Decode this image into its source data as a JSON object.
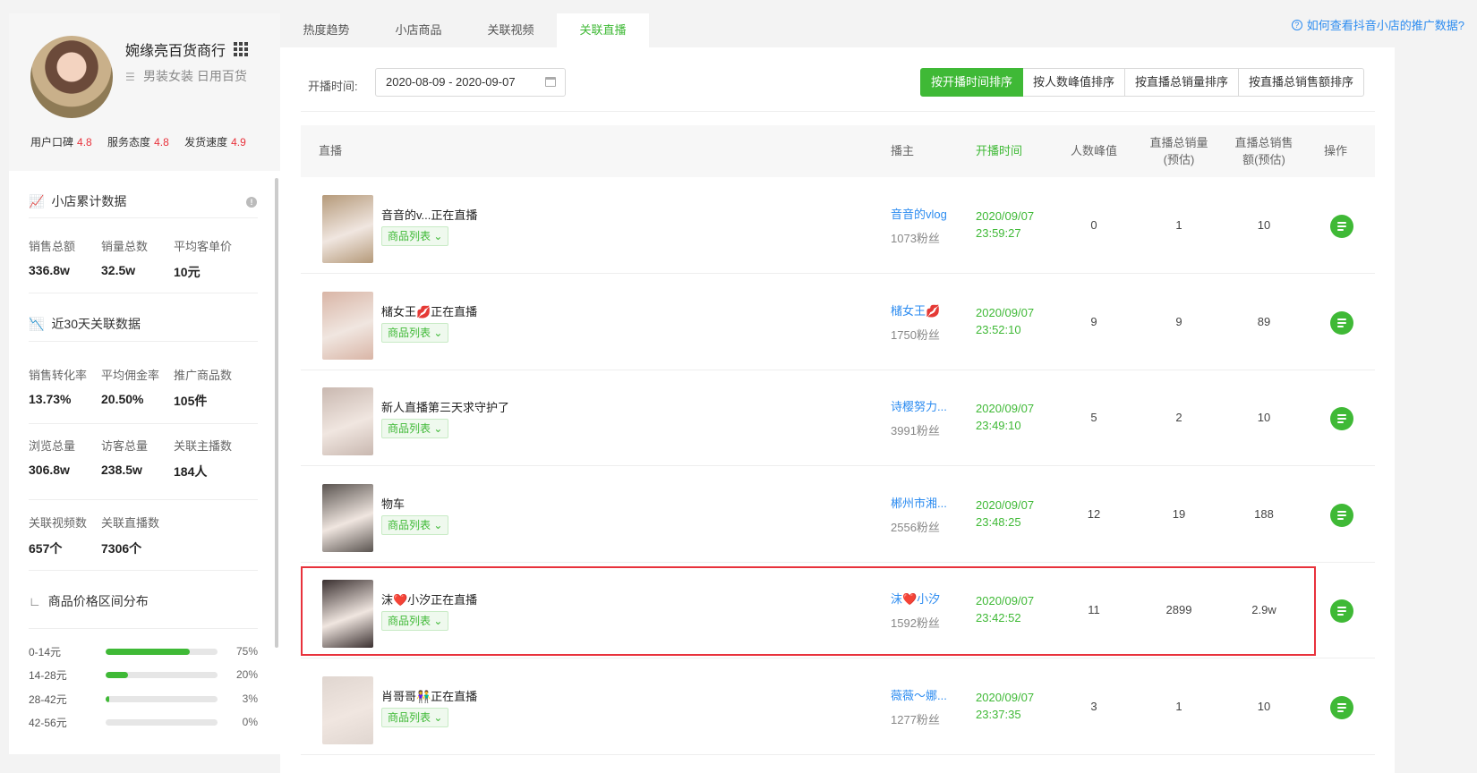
{
  "shop": {
    "name": "婉缘亮百货商行",
    "category": "男装女装 日用百货",
    "ratings": [
      {
        "label": "用户口碑",
        "value": "4.8"
      },
      {
        "label": "服务态度",
        "value": "4.8"
      },
      {
        "label": "发货速度",
        "value": "4.9"
      }
    ]
  },
  "cumulative": {
    "title": "小店累计数据",
    "stats": [
      {
        "label": "销售总额",
        "value": "336.8w"
      },
      {
        "label": "销量总数",
        "value": "32.5w"
      },
      {
        "label": "平均客单价",
        "value": "10元"
      }
    ]
  },
  "recent": {
    "title": "近30天关联数据",
    "stats": [
      {
        "label": "销售转化率",
        "value": "13.73%"
      },
      {
        "label": "平均佣金率",
        "value": "20.50%"
      },
      {
        "label": "推广商品数",
        "value": "105件"
      },
      {
        "label": "浏览总量",
        "value": "306.8w"
      },
      {
        "label": "访客总量",
        "value": "238.5w"
      },
      {
        "label": "关联主播数",
        "value": "184人"
      },
      {
        "label": "关联视频数",
        "value": "657个"
      },
      {
        "label": "关联直播数",
        "value": "7306个"
      }
    ]
  },
  "price": {
    "title": "商品价格区间分布",
    "ranges": [
      {
        "label": "0-14元",
        "pct": "75%",
        "ratio": 0.75
      },
      {
        "label": "14-28元",
        "pct": "20%",
        "ratio": 0.2
      },
      {
        "label": "28-42元",
        "pct": "3%",
        "ratio": 0.03
      },
      {
        "label": "42-56元",
        "pct": "0%",
        "ratio": 0.0
      }
    ]
  },
  "tabs": [
    "热度趋势",
    "小店商品",
    "关联视频",
    "关联直播"
  ],
  "help_link": "如何查看抖音小店的推广数据?",
  "filter": {
    "label": "开播时间:",
    "date_range": "2020-08-09 - 2020-09-07"
  },
  "sort_buttons": [
    "按开播时间排序",
    "按人数峰值排序",
    "按直播总销量排序",
    "按直播总销售额排序"
  ],
  "columns": {
    "live": "直播",
    "host": "播主",
    "start_time": "开播时间",
    "peak": "人数峰值",
    "sales_l1": "直播总销量",
    "sales_l2": "(预估)",
    "amount_l1": "直播总销售",
    "amount_l2": "额(预估)",
    "op": "操作"
  },
  "goods_label": "商品列表",
  "rows": [
    {
      "title": "音音的v...正在直播",
      "host": "音音的vlog",
      "fans": "1073粉丝",
      "date": "2020/09/07",
      "time": "23:59:27",
      "peak": "0",
      "sales": "1",
      "amount": "10",
      "thumb": "#b59a7a"
    },
    {
      "title": "槠女王💋正在直播",
      "host": "槠女王💋",
      "fans": "1750粉丝",
      "date": "2020/09/07",
      "time": "23:52:10",
      "peak": "9",
      "sales": "9",
      "amount": "89",
      "thumb": "#d9b5a6"
    },
    {
      "title": "新人直播第三天求守护了",
      "host": "诗樱努力...",
      "fans": "3991粉丝",
      "date": "2020/09/07",
      "time": "23:49:10",
      "peak": "5",
      "sales": "2",
      "amount": "10",
      "thumb": "#c9b8b0"
    },
    {
      "title": "物车",
      "host": "郴州市湘...",
      "fans": "2556粉丝",
      "date": "2020/09/07",
      "time": "23:48:25",
      "peak": "12",
      "sales": "19",
      "amount": "188",
      "thumb": "#5a5450"
    },
    {
      "title": "沫❤️小汐正在直播",
      "host": "沫❤️小汐",
      "fans": "1592粉丝",
      "date": "2020/09/07",
      "time": "23:42:52",
      "peak": "11",
      "sales": "2899",
      "amount": "2.9w",
      "thumb": "#3a3030"
    },
    {
      "title": "肖哥哥👫正在直播",
      "host": "薇薇～娜...",
      "fans": "1277粉丝",
      "date": "2020/09/07",
      "time": "23:37:35",
      "peak": "3",
      "sales": "1",
      "amount": "10",
      "thumb": "#e0d6d0"
    }
  ],
  "colors": {
    "accent": "#3fb936",
    "link": "#2d8cf0",
    "rating": "#e8323c",
    "highlight": "#e8323c"
  }
}
